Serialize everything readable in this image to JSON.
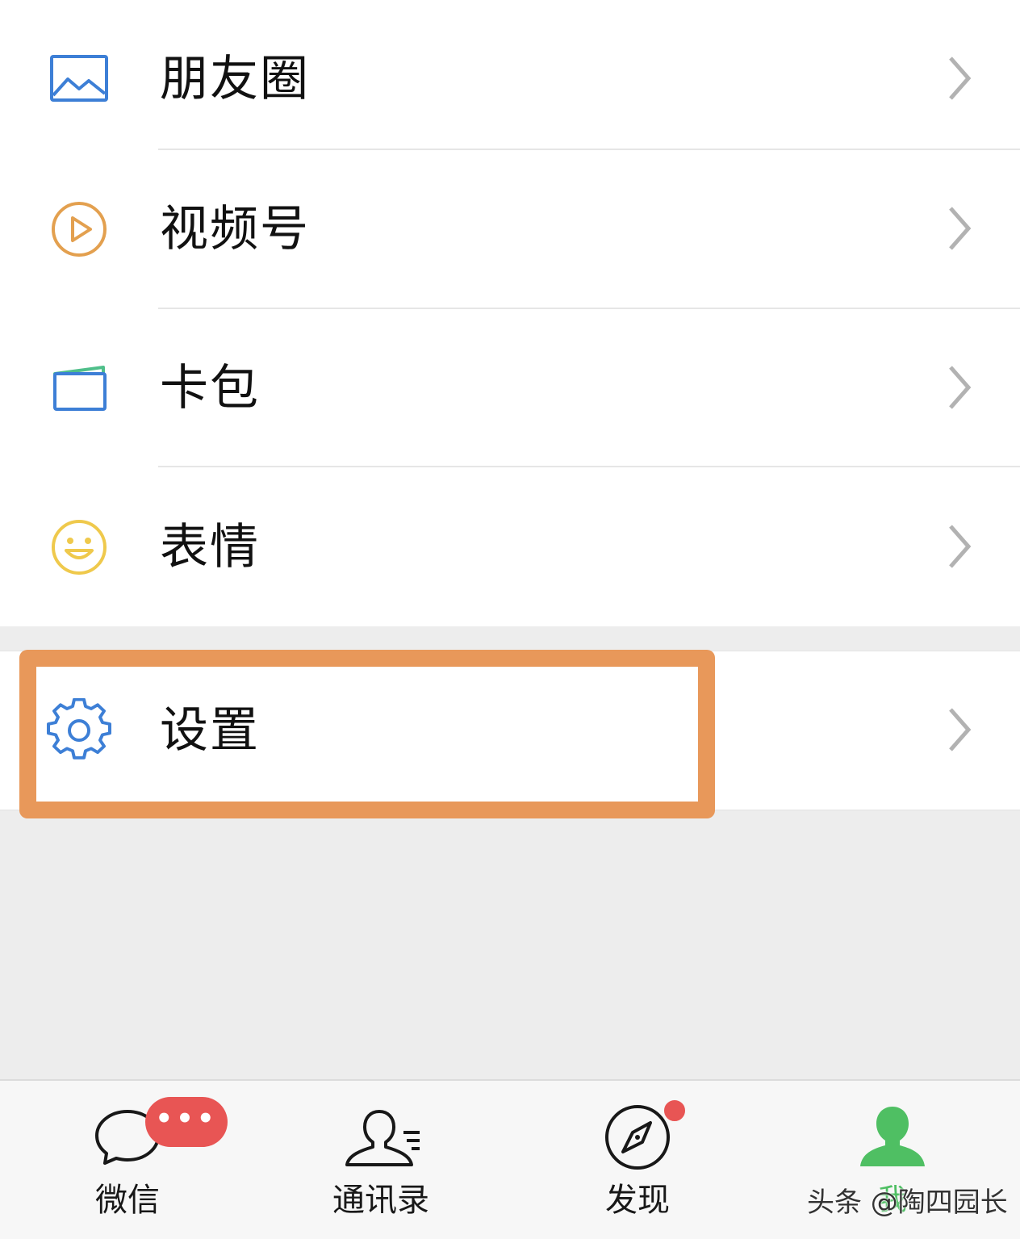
{
  "menu": {
    "items": [
      {
        "label": "朋友圈",
        "icon": "moments-icon"
      },
      {
        "label": "视频号",
        "icon": "channels-icon"
      },
      {
        "label": "卡包",
        "icon": "card-wallet-icon"
      },
      {
        "label": "表情",
        "icon": "sticker-icon"
      }
    ],
    "settings": {
      "label": "设置",
      "icon": "gear-icon"
    }
  },
  "tabbar": {
    "tabs": [
      {
        "label": "微信",
        "icon": "chat-bubble-icon"
      },
      {
        "label": "通讯录",
        "icon": "contacts-icon"
      },
      {
        "label": "发现",
        "icon": "compass-icon"
      },
      {
        "label": "我",
        "icon": "person-icon",
        "active": true
      }
    ],
    "chat_badge": "•••"
  },
  "watermark": "头条 @陶四园长",
  "colors": {
    "highlight": "#e8985a",
    "active_green": "#4fbf63",
    "badge_red": "#e85554",
    "moments_blue": "#3d7fd6",
    "channels_orange": "#e3a04f",
    "sticker_yellow": "#efc94c"
  }
}
